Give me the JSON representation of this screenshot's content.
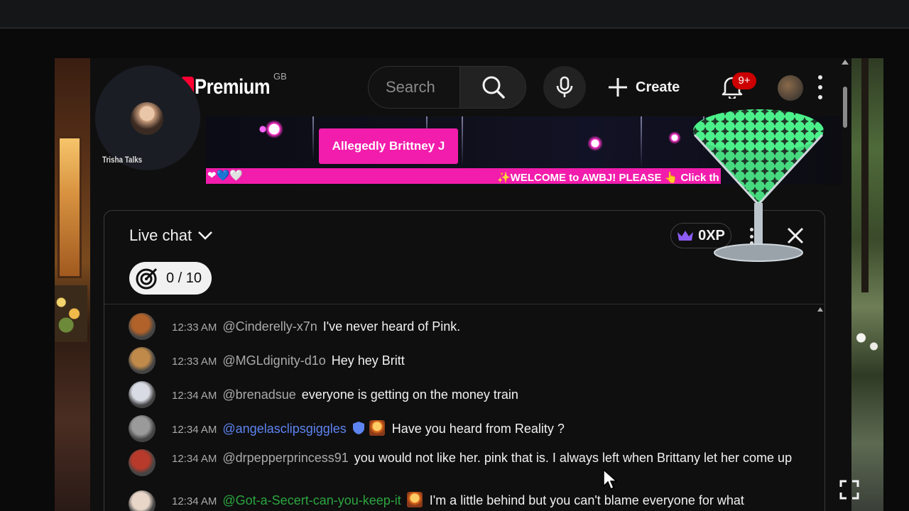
{
  "header": {
    "logo_text": "Premium",
    "region": "GB",
    "search_placeholder": "Search",
    "create_label": "Create",
    "notifications_badge": "9+"
  },
  "streamer": {
    "name": "Trisha Talks"
  },
  "stream": {
    "title": "Allegedly Brittney J",
    "ticker_hearts": "❤💙🤍",
    "ticker_text": "✨WELCOME to AWBJ! PLEASE 👆 Click th"
  },
  "chat": {
    "title": "Live chat",
    "xp_label": "0XP",
    "goal_label": "0 / 10",
    "messages": [
      {
        "time": "12:33 AM",
        "author": "@Cinderelly-x7n",
        "text": "I've never heard of Pink.",
        "avatar_color": "#b0622a"
      },
      {
        "time": "12:33 AM",
        "author": "@MGLdignity-d1o",
        "text": "Hey hey Britt",
        "avatar_color": "#c08a4a"
      },
      {
        "time": "12:34 AM",
        "author": "@brenadsue",
        "text": "everyone is getting on the money train",
        "avatar_color": "#d8dbe4"
      },
      {
        "time": "12:34 AM",
        "author": "@angelasclipsgiggles",
        "text": "Have you heard from Reality ?",
        "avatar_color": "#9a9a9a"
      },
      {
        "time": "12:34 AM",
        "author": "@drpepperprincess91",
        "text": "you would not like her. pink that is. I always left when Brittany let her come up",
        "avatar_color": "#b83a2a"
      },
      {
        "time": "12:34 AM",
        "author": "@Got-a-Secert-can-you-keep-it",
        "text": "I'm a little behind but you can't blame everyone for what",
        "avatar_color": "#e8d6c8"
      }
    ]
  },
  "colors": {
    "accent_pink": "#f21dac",
    "mod_blue": "#5e84f1",
    "member_green": "#2ba640",
    "badge_red": "#cc0000"
  }
}
